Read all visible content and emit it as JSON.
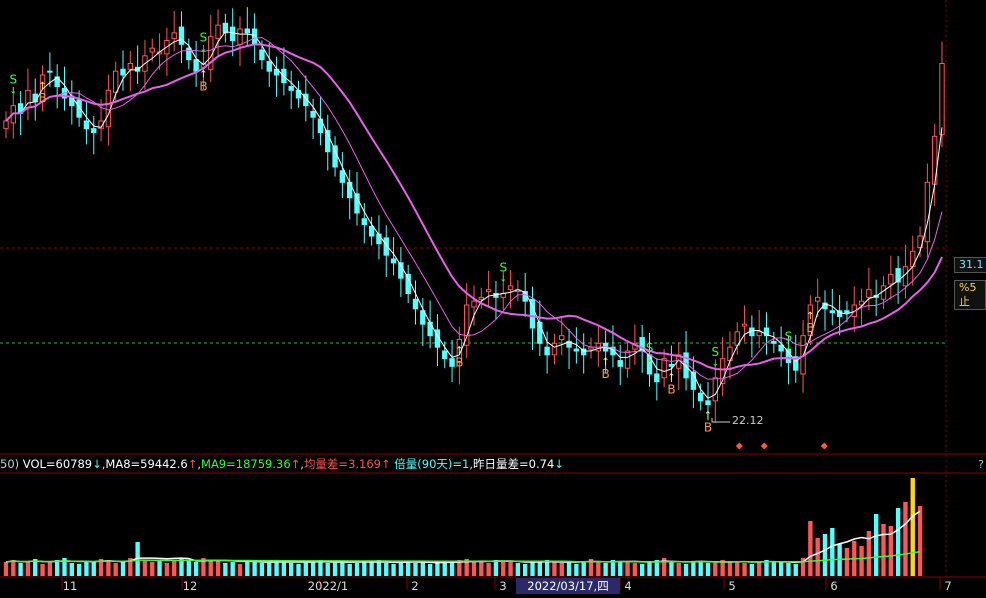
{
  "colors": {
    "up": "#ff5555",
    "down": "#54ffff",
    "ma_short": "#ffffff",
    "ma_long": "#e860e8",
    "buy": "#ff9933",
    "sell": "#33ff33",
    "vol_ma": "#33ff33",
    "grid": "#8b0000"
  },
  "price_labels": {
    "low_annotation": "22.12",
    "right_tag_1": "31.1",
    "right_tag_2": "%5止"
  },
  "signals": {
    "buy_label": "B",
    "sell_label": "S"
  },
  "volume_indicator": {
    "prefix": "50)",
    "vol": "VOL=60789",
    "vol_arrow": "↓",
    "ma8": "MA8=59442.6",
    "ma8_arrow": "↑",
    "ma9": "MA9=18759.36",
    "ma9_arrow": "↑",
    "avg_diff": "均量差=3.169",
    "avg_diff_arrow": "↑",
    "ratio": "倍量(90天)=1",
    "prev_diff": "昨日量差=0.74",
    "prev_diff_arrow": "↓",
    "help": "?"
  },
  "x_axis": {
    "labels": [
      "11",
      "12",
      "2022/1",
      "2",
      "3",
      "4",
      "5",
      "6",
      "7"
    ],
    "cursor_date": "2022/03/17,四"
  },
  "chart_data": {
    "type": "candlestick",
    "title": "",
    "low_marked": 22.12,
    "last_close_tag": 31.1,
    "close_series": [
      29.6,
      30.0,
      29.8,
      30.4,
      30.1,
      30.8,
      30.9,
      30.5,
      30.2,
      30.0,
      29.7,
      29.4,
      29.3,
      29.6,
      30.4,
      30.9,
      30.8,
      31.1,
      30.9,
      31.3,
      31.5,
      31.4,
      31.7,
      31.9,
      31.6,
      31.2,
      30.9,
      31.1,
      31.8,
      32.1,
      31.9,
      31.7,
      32.0,
      31.9,
      31.6,
      31.2,
      30.9,
      30.8,
      30.6,
      30.4,
      30.2,
      30.0,
      29.7,
      29.3,
      28.8,
      28.4,
      28.0,
      27.6,
      27.2,
      26.9,
      26.6,
      26.4,
      26.1,
      25.9,
      25.5,
      25.1,
      24.7,
      24.3,
      24.0,
      23.7,
      23.4,
      23.2,
      23.9,
      24.8,
      24.9,
      25.0,
      25.2,
      25.0,
      25.1,
      25.3,
      25.2,
      24.9,
      24.2,
      23.8,
      23.5,
      23.8,
      24.0,
      23.7,
      23.6,
      23.5,
      23.7,
      23.8,
      23.6,
      23.5,
      23.2,
      23.6,
      23.8,
      23.6,
      23.0,
      22.8,
      23.4,
      23.2,
      23.5,
      22.9,
      22.6,
      22.3,
      22.2,
      22.9,
      23.4,
      23.7,
      24.1,
      24.3,
      24.0,
      24.1,
      24.0,
      23.8,
      23.6,
      23.3,
      23.1,
      24.0,
      24.8,
      25.0,
      24.7,
      24.6,
      24.5,
      24.6,
      24.8,
      24.9,
      25.2,
      25.0,
      25.3,
      25.6,
      25.4,
      25.8,
      26.2,
      26.6,
      28.0,
      29.2,
      31.1
    ],
    "volume_series": [
      14,
      16,
      13,
      15,
      17,
      12,
      14,
      16,
      18,
      13,
      12,
      15,
      14,
      17,
      16,
      13,
      15,
      18,
      34,
      16,
      14,
      15,
      13,
      16,
      17,
      15,
      14,
      18,
      16,
      15,
      13,
      14,
      12,
      15,
      14,
      13,
      15,
      16,
      14,
      13,
      12,
      15,
      14,
      16,
      13,
      15,
      14,
      12,
      13,
      15,
      14,
      16,
      13,
      12,
      14,
      15,
      13,
      14,
      12,
      13,
      15,
      14,
      16,
      17,
      15,
      14,
      13,
      16,
      15,
      14,
      13,
      12,
      15,
      14,
      16,
      15,
      13,
      14,
      12,
      15,
      17,
      14,
      13,
      16,
      15,
      14,
      13,
      12,
      15,
      16,
      18,
      14,
      13,
      12,
      15,
      14,
      13,
      15,
      16,
      14,
      15,
      13,
      12,
      14,
      16,
      15,
      14,
      13,
      12,
      18,
      55,
      38,
      42,
      48,
      32,
      28,
      35,
      30,
      45,
      62,
      52,
      50,
      68,
      74,
      98,
      70
    ],
    "buy_signal_indices": [
      5,
      27,
      62,
      82,
      91,
      96,
      110
    ],
    "sell_signal_indices": [
      1,
      27,
      68,
      88,
      97,
      107
    ]
  }
}
